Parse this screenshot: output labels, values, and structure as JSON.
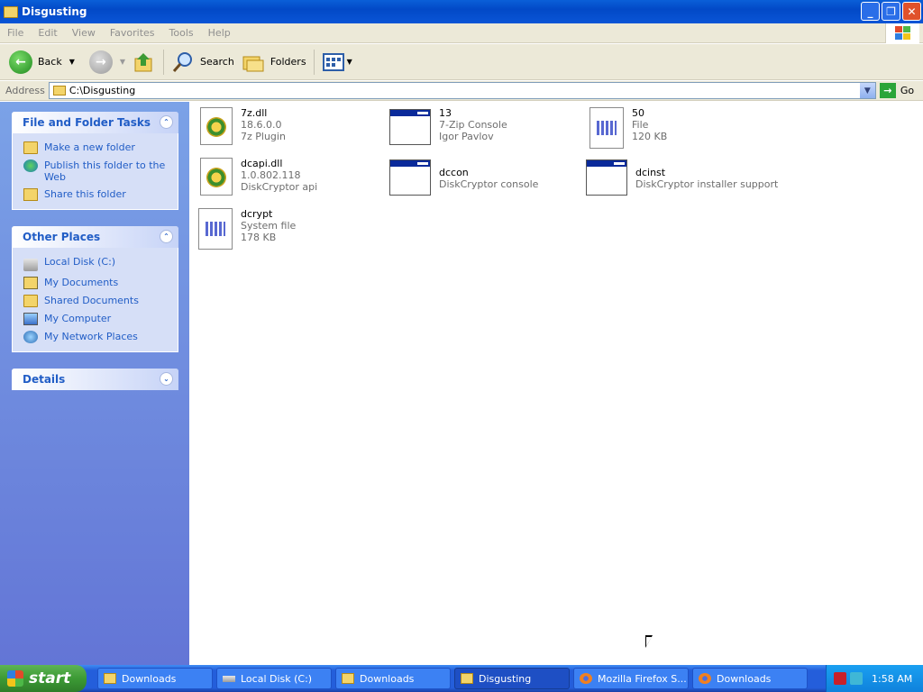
{
  "window": {
    "title": "Disgusting"
  },
  "menu": [
    "File",
    "Edit",
    "View",
    "Favorites",
    "Tools",
    "Help"
  ],
  "toolbar": {
    "back": "Back",
    "search": "Search",
    "folders": "Folders"
  },
  "address": {
    "label": "Address",
    "value": "C:\\Disgusting",
    "go": "Go"
  },
  "left_pane": {
    "tasks": {
      "title": "File and Folder Tasks",
      "items": [
        "Make a new folder",
        "Publish this folder to the Web",
        "Share this folder"
      ]
    },
    "other_places": {
      "title": "Other Places",
      "items": [
        "Local Disk (C:)",
        "My Documents",
        "Shared Documents",
        "My Computer",
        "My Network Places"
      ]
    },
    "details": {
      "title": "Details"
    }
  },
  "files": [
    {
      "name": "7z.dll",
      "line2": "18.6.0.0",
      "line3": "7z Plugin",
      "icon": "dll-icon"
    },
    {
      "name": "13",
      "line2": "7-Zip Console",
      "line3": "Igor Pavlov",
      "icon": "console-icon"
    },
    {
      "name": "50",
      "line2": "File",
      "line3": "120 KB",
      "icon": "system-file-icon"
    },
    {
      "name": "dcapi.dll",
      "line2": "1.0.802.118",
      "line3": "DiskCryptor api",
      "icon": "dll-icon"
    },
    {
      "name": "dccon",
      "line2": "DiskCryptor console",
      "line3": "",
      "icon": "console-icon"
    },
    {
      "name": "dcinst",
      "line2": "DiskCryptor installer support",
      "line3": "",
      "icon": "console-icon"
    },
    {
      "name": "dcrypt",
      "line2": "System file",
      "line3": "178 KB",
      "icon": "system-file-icon"
    }
  ],
  "taskbar": {
    "start": "start",
    "tasks": [
      "Downloads",
      "Local Disk (C:)",
      "Downloads",
      "Disgusting",
      "Mozilla Firefox S...",
      "Downloads"
    ],
    "clock": "1:58 AM"
  }
}
